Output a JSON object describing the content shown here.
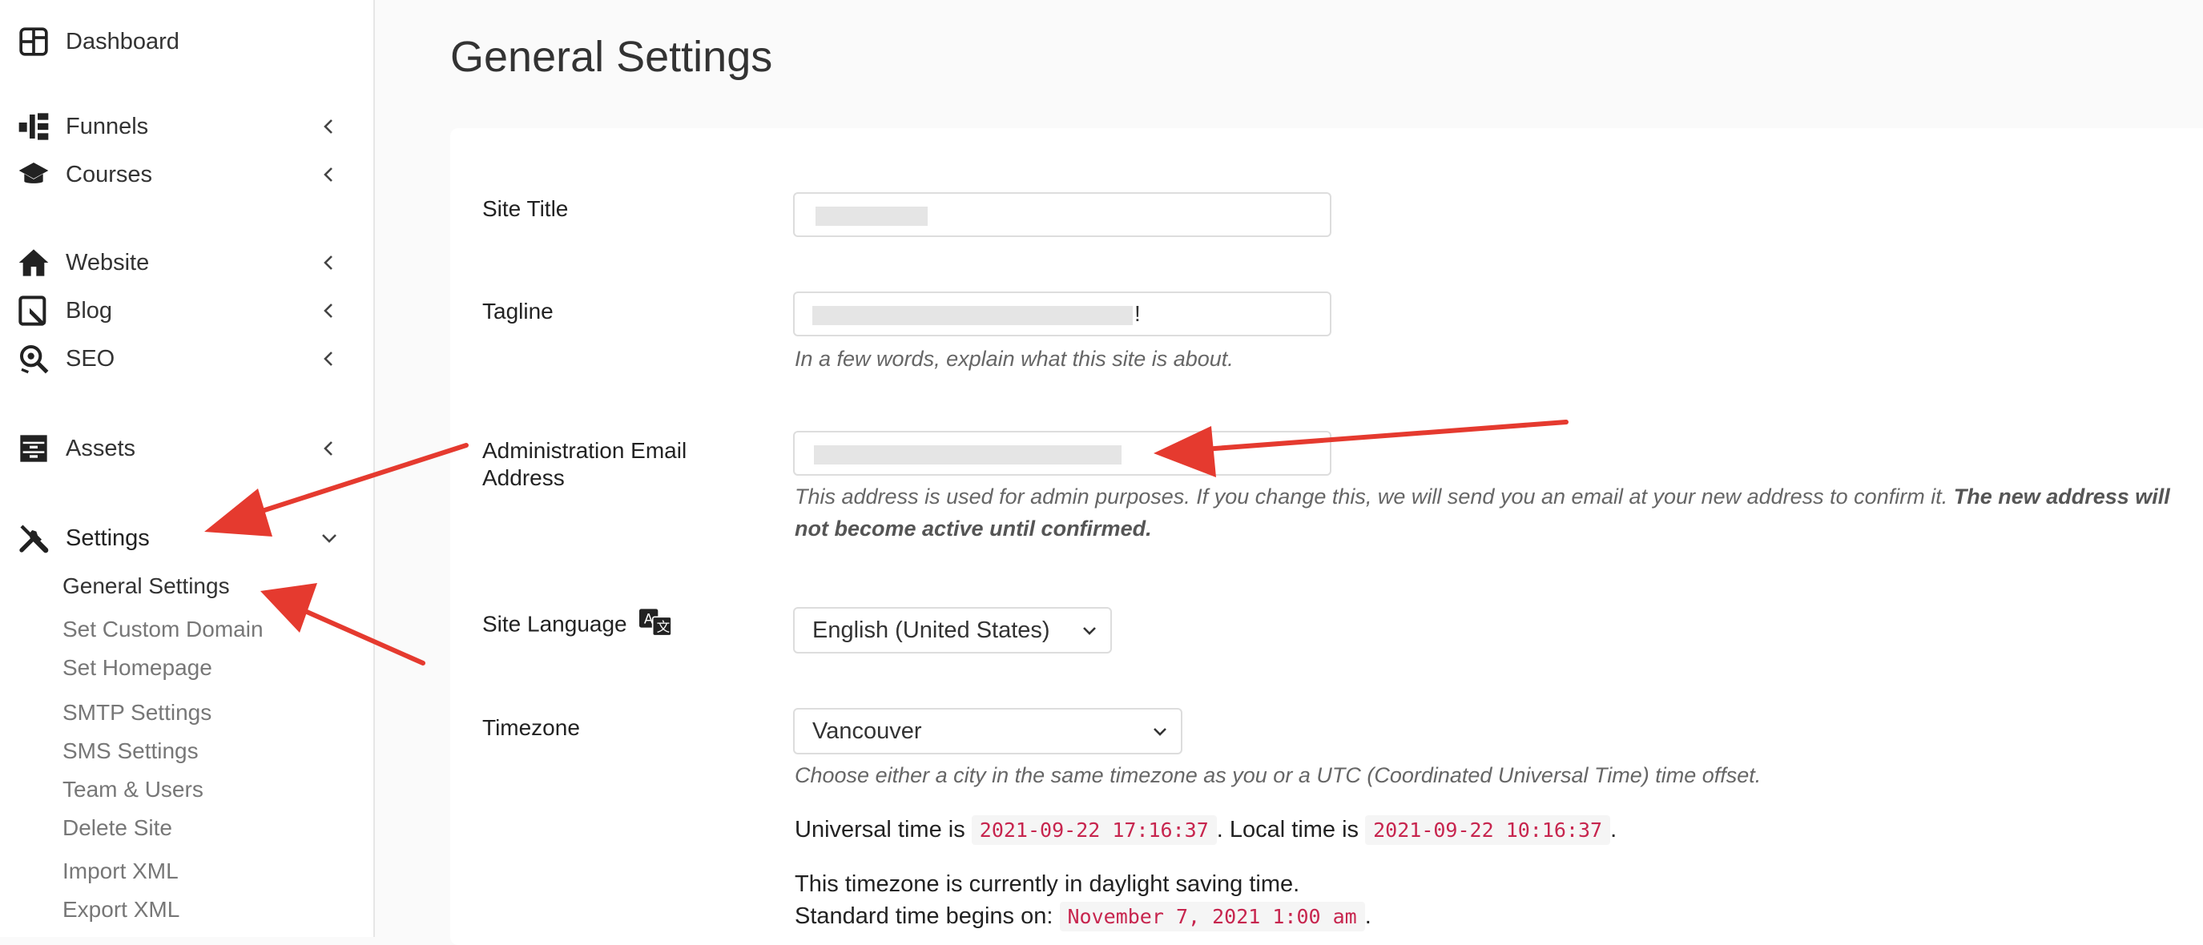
{
  "sidebar": {
    "dashboard": "Dashboard",
    "funnels": "Funnels",
    "courses": "Courses",
    "website": "Website",
    "blog": "Blog",
    "seo": "SEO",
    "assets": "Assets",
    "settings": "Settings",
    "submenu": [
      "General Settings",
      "Set Custom Domain",
      "Set Homepage",
      "SMTP Settings",
      "SMS Settings",
      "Team & Users",
      "Delete Site",
      "Import XML",
      "Export XML"
    ]
  },
  "page": {
    "title": "General Settings"
  },
  "form": {
    "site_title_label": "Site Title",
    "tagline_label": "Tagline",
    "tagline_suffix": "!",
    "tagline_help": "In a few words, explain what this site is about.",
    "admin_email_label": "Administration Email Address",
    "admin_email_help": "This address is used for admin purposes. If you change this, we will send you an email at your new address to confirm it.",
    "admin_email_help_bold": "The new address will not become active until confirmed.",
    "site_language_label": "Site Language",
    "site_language_value": "English (United States)",
    "timezone_label": "Timezone",
    "timezone_value": "Vancouver",
    "timezone_help": "Choose either a city in the same timezone as you or a UTC (Coordinated Universal Time) time offset.",
    "universal_prefix": "Universal time is",
    "universal_time": "2021-09-22 17:16:37",
    "local_prefix": ". Local time is",
    "local_time": "2021-09-22 10:16:37",
    "period": ".",
    "dst_text": "This timezone is currently in daylight saving time.",
    "standard_prefix": "Standard time begins on:",
    "standard_time": "November 7, 2021 1:00 am"
  },
  "colors": {
    "arrow": "#e53a2f",
    "code_text": "#c7254e"
  }
}
